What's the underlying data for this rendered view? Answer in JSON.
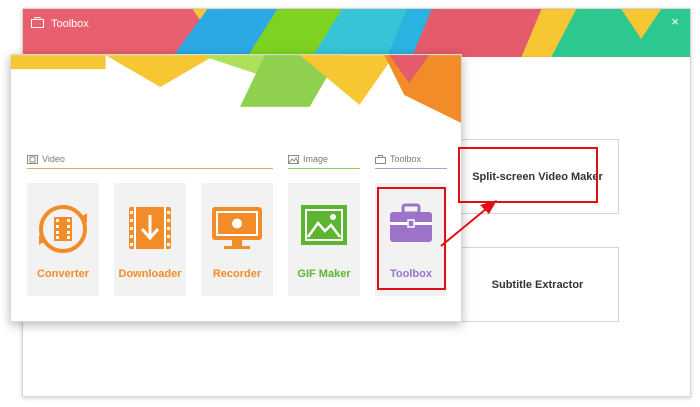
{
  "back_window": {
    "title": "Toolbox",
    "close_glyph": "×",
    "cards": [
      {
        "label": "Split-screen Video Maker"
      },
      {
        "label": "Subtitle Extractor"
      }
    ]
  },
  "front_window": {
    "sections": [
      {
        "label": "Video",
        "icon": "film-icon",
        "color": "#f4a35a"
      },
      {
        "label": "Image",
        "icon": "image-icon",
        "color": "#8fd14f"
      },
      {
        "label": "Toolbox",
        "icon": "toolbox-icon",
        "color": "#b99ad6"
      }
    ],
    "tools": [
      {
        "label": "Converter",
        "icon": "converter-icon",
        "color": "#f28c28"
      },
      {
        "label": "Downloader",
        "icon": "downloader-icon",
        "color": "#f28c28"
      },
      {
        "label": "Recorder",
        "icon": "recorder-icon",
        "color": "#f28c28"
      },
      {
        "label": "GIF Maker",
        "icon": "gif-maker-icon",
        "color": "#5cb531"
      },
      {
        "label": "Toolbox",
        "icon": "toolbox-icon",
        "color": "#9d72c9"
      }
    ]
  },
  "annotations": {
    "highlight_color": "#e10e16"
  }
}
